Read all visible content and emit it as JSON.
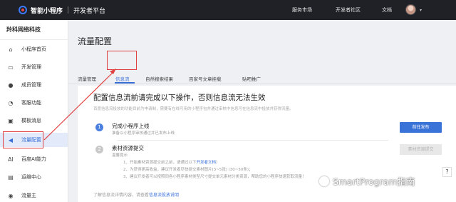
{
  "topbar": {
    "logo_text": "智能小程序",
    "section": "开发者平台",
    "nav": [
      "服务市场",
      "开发者社区",
      "文档"
    ],
    "avatar_caret": "▾"
  },
  "sidebar": {
    "company": "羚科网络科技",
    "items": [
      {
        "label": "小程序首页",
        "icon": "home-icon",
        "glyph": "⌂"
      },
      {
        "label": "开发管理",
        "icon": "code-icon",
        "glyph": "▭"
      },
      {
        "label": "成员管理",
        "icon": "user-icon",
        "glyph": "●"
      },
      {
        "label": "客服功能",
        "icon": "headset-icon",
        "glyph": "◔"
      },
      {
        "label": "模板消息",
        "icon": "message-icon",
        "glyph": "▣"
      },
      {
        "label": "流量配置",
        "icon": "megaphone-icon",
        "glyph": "◀"
      },
      {
        "label": "百度AI能力",
        "icon": "ai-icon",
        "glyph": "AI"
      },
      {
        "label": "运维中心",
        "icon": "monitor-icon",
        "glyph": "▤"
      },
      {
        "label": "流量主",
        "icon": "coin-icon",
        "glyph": "◉"
      }
    ]
  },
  "main": {
    "title": "流量配置",
    "tabs": [
      "流量管理",
      "信息流",
      "自然搜索结果",
      "百家号文章挂载",
      "贴吧推广"
    ],
    "active_tab": 1
  },
  "card": {
    "title": "配置信息流前请完成以下操作，否则信息流无法生效",
    "desc": "百度信息流投放的功能目前为申请制，需要有在线可用的小程序包并通过审核中信息可在信息流中投放并获得流量。",
    "steps": [
      {
        "num": "1",
        "title": "完成小程序上线",
        "sub": "准备以小程序审核通过并已发布上线",
        "button": "前往发布"
      },
      {
        "num": "2",
        "title": "素材资源提交",
        "sub": "温馨提示",
        "button": "素材资源提交"
      }
    ],
    "notes": [
      {
        "text": "1、开始素材资源提交前之前，请通过以下",
        "link": "开发者文档",
        "tail": "）"
      },
      {
        "text": "2、为获得更高收益，建议开发者尽快提交素材图片(3~5张) (30~50条)；",
        "link": "",
        "tail": ""
      },
      {
        "text": "3、建议开发者可以按照同各小程序素材类型尺寸提交单元素材分类资源，帮助您的小程序快速获取流量！",
        "link": "",
        "tail": ""
      }
    ],
    "footer_text": "了解信息流详情内容，请查看",
    "footer_link": "信息流投放说明"
  },
  "float_button": "?",
  "watermark": "SmartProgram指南",
  "colors": {
    "accent": "#3a6fd8",
    "highlight": "#e0403f",
    "topbar": "#1f2126"
  }
}
